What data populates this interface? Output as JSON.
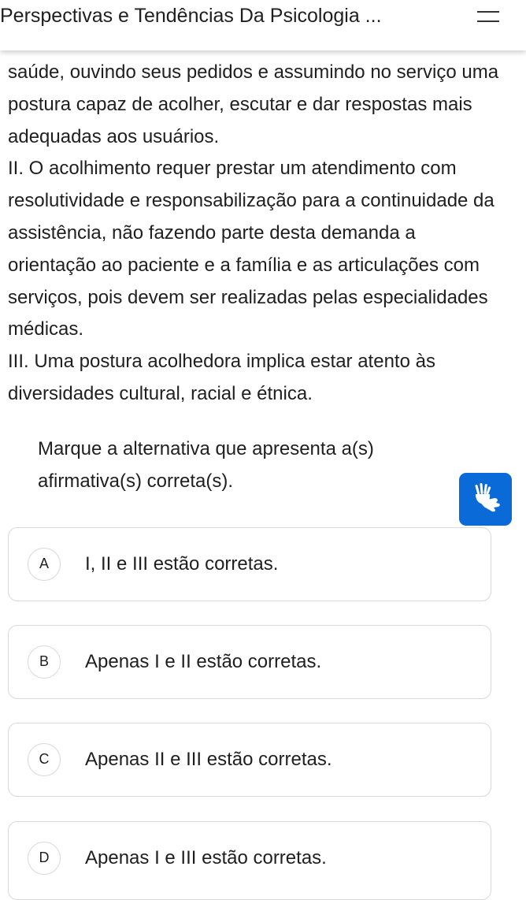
{
  "header": {
    "title": "Perspectivas e Tendências Da Psicologia ...",
    "menu_icon": "hamburger-menu-icon"
  },
  "question": {
    "paragraphs": [
      "saúde, ouvindo seus pedidos e assumindo no serviço uma postura capaz de acolher, escutar e dar respostas mais adequadas aos usuários.",
      "II. O acolhimento requer prestar um atendimento com resolutividade e responsabilização para a continuidade da assistência, não fazendo parte desta demanda a orientação ao paciente e a família e as articulações com serviços, pois devem ser realizadas pelas especialidades médicas.",
      "III. Uma postura acolhedora implica estar atento às diversidades cultural, racial e étnica."
    ],
    "prompt": "Marque a alternativa que apresenta a(s) afirmativa(s) correta(s).",
    "accessibility_icon": "sign-language-hands-icon"
  },
  "options": [
    {
      "letter": "A",
      "text": "I, II e III estão corretas."
    },
    {
      "letter": "B",
      "text": "Apenas I e II estão corretas."
    },
    {
      "letter": "C",
      "text": "Apenas II e III estão corretas."
    },
    {
      "letter": "D",
      "text": "Apenas I e III estão corretas."
    }
  ],
  "colors": {
    "accent": "#0a6ad8",
    "text": "#1f1f1f",
    "border": "#d9d9d9"
  }
}
